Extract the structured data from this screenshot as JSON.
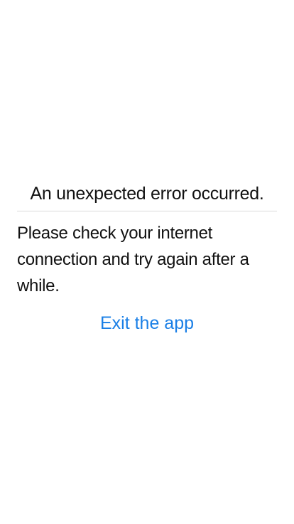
{
  "error": {
    "title": "An unexpected error occurred.",
    "message": "Please check your internet connection and try again after a while.",
    "exit_label": "Exit the app"
  },
  "colors": {
    "link": "#1a7fe6",
    "divider": "#d9d9d9",
    "text": "#111111",
    "background": "#ffffff"
  }
}
